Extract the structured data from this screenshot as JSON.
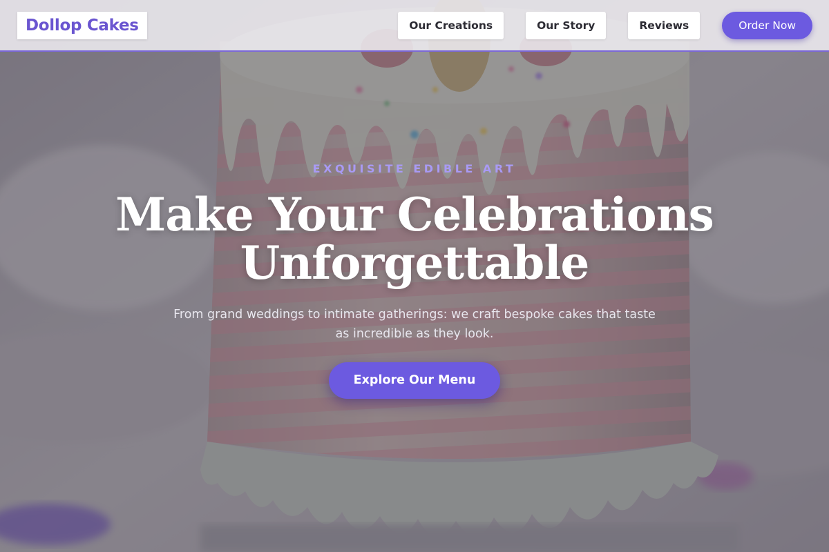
{
  "header": {
    "logo_text": "Dollop Cakes",
    "nav": [
      {
        "label": "Our Creations"
      },
      {
        "label": "Our Story"
      },
      {
        "label": "Reviews"
      }
    ],
    "order_label": "Order Now"
  },
  "hero": {
    "eyebrow": "EXQUISITE EDIBLE ART",
    "title_line1": "Make Your Celebrations",
    "title_line2": "Unforgettable",
    "subtitle": "From grand weddings to intimate gatherings: we craft bespoke cakes that taste as incredible as they look.",
    "cta_label": "Explore Our Menu"
  },
  "colors": {
    "accent": "#6c5ae0",
    "logo": "#6a55d0",
    "eyebrow": "#a99af5"
  }
}
